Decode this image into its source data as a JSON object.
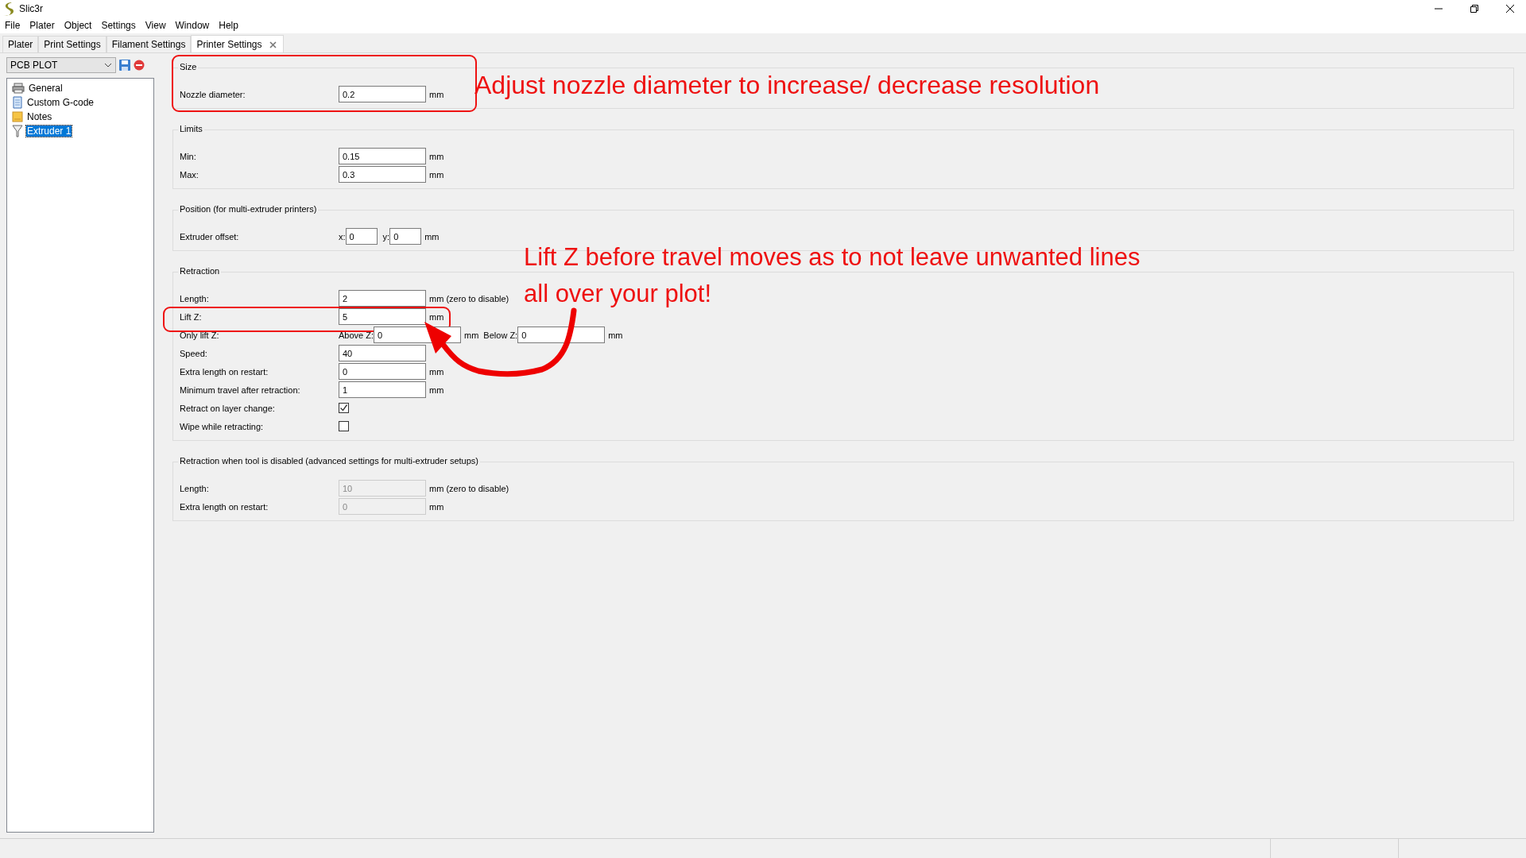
{
  "window": {
    "title": "Slic3r"
  },
  "menu": [
    "File",
    "Plater",
    "Object",
    "Settings",
    "View",
    "Window",
    "Help"
  ],
  "tabs": [
    {
      "label": "Plater",
      "selected": false,
      "closable": false
    },
    {
      "label": "Print Settings",
      "selected": false,
      "closable": false
    },
    {
      "label": "Filament Settings",
      "selected": false,
      "closable": false
    },
    {
      "label": "Printer Settings",
      "selected": true,
      "closable": true
    }
  ],
  "preset": {
    "value": "PCB PLOT"
  },
  "tree": [
    {
      "label": "General",
      "kind": "printer",
      "selected": false
    },
    {
      "label": "Custom G-code",
      "kind": "script",
      "selected": false
    },
    {
      "label": "Notes",
      "kind": "notes",
      "selected": false
    },
    {
      "label": "Extruder 1",
      "kind": "extruder",
      "selected": true
    }
  ],
  "sections": [
    {
      "title": "Size",
      "highlighted": true,
      "rows": [
        {
          "kind": "field",
          "label": "Nozzle diameter:",
          "value": "0.2",
          "unit": "mm",
          "disabled": false,
          "highlighted": false
        }
      ]
    },
    {
      "title": "Limits",
      "highlighted": false,
      "rows": [
        {
          "kind": "field",
          "label": "Min:",
          "value": "0.15",
          "unit": "mm",
          "disabled": false,
          "highlighted": false
        },
        {
          "kind": "field",
          "label": "Max:",
          "value": "0.3",
          "unit": "mm",
          "disabled": false,
          "highlighted": false
        }
      ]
    },
    {
      "title": "Position (for multi-extruder printers)",
      "highlighted": false,
      "rows": [
        {
          "kind": "xy",
          "label": "Extruder offset:",
          "x_label": "x:",
          "x_value": "0",
          "y_label": "y:",
          "y_value": "0",
          "unit": "mm",
          "highlighted": false
        }
      ]
    },
    {
      "title": "Retraction",
      "highlighted": false,
      "rows": [
        {
          "kind": "field",
          "label": "Length:",
          "value": "2",
          "unit": "mm (zero to disable)",
          "disabled": false,
          "highlighted": false
        },
        {
          "kind": "field",
          "label": "Lift Z:",
          "value": "5",
          "unit": "mm",
          "disabled": false,
          "highlighted": true
        },
        {
          "kind": "range",
          "label": "Only lift Z:",
          "above_label": "Above Z:",
          "above_value": "0",
          "above_unit": "mm",
          "below_label": "Below Z:",
          "below_value": "0",
          "below_unit": "mm",
          "highlighted": false
        },
        {
          "kind": "field",
          "label": "Speed:",
          "value": "40",
          "disabled": false,
          "highlighted": false
        },
        {
          "kind": "field",
          "label": "Extra length on restart:",
          "value": "0",
          "unit": "mm",
          "disabled": false,
          "highlighted": false
        },
        {
          "kind": "field",
          "label": "Minimum travel after retraction:",
          "value": "1",
          "unit": "mm",
          "disabled": false,
          "highlighted": false
        },
        {
          "kind": "checkbox",
          "label": "Retract on layer change:",
          "checked": true,
          "highlighted": false
        },
        {
          "kind": "checkbox",
          "label": "Wipe while retracting:",
          "checked": false,
          "highlighted": false
        }
      ]
    },
    {
      "title": "Retraction when tool is disabled (advanced settings for multi-extruder setups)",
      "highlighted": false,
      "rows": [
        {
          "kind": "field",
          "label": "Length:",
          "value": "10",
          "unit": "mm (zero to disable)",
          "disabled": true,
          "highlighted": false
        },
        {
          "kind": "field",
          "label": "Extra length on restart:",
          "value": "0",
          "unit": "mm",
          "disabled": true,
          "highlighted": false
        }
      ]
    }
  ],
  "annotations": [
    {
      "lines": [
        "Adjust nozzle diameter to increase/ decrease resolution"
      ]
    },
    {
      "lines": [
        "Lift Z before travel moves as to not leave unwanted lines",
        "all over your plot!"
      ]
    }
  ]
}
